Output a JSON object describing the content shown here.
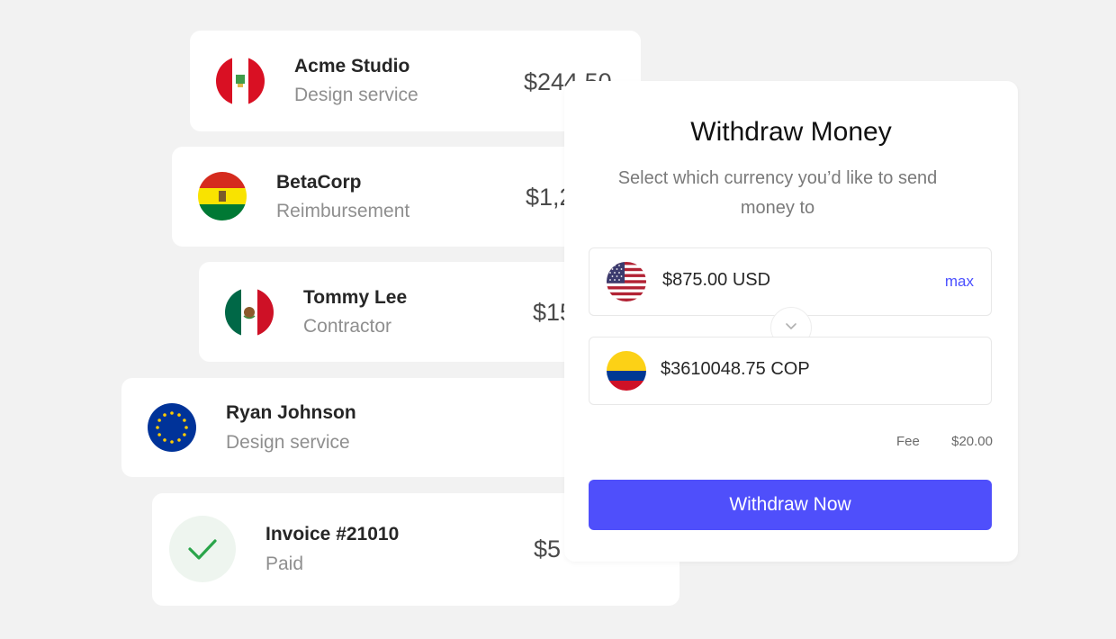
{
  "transactions": [
    {
      "name": "Acme Studio",
      "description": "Design service",
      "amount": "$244.50",
      "flag_icon": "peru-flag-icon"
    },
    {
      "name": "BetaCorp",
      "description": "Reimbursement",
      "amount": "$1,2",
      "flag_icon": "bolivia-flag-icon"
    },
    {
      "name": "Tommy Lee",
      "description": "Contractor",
      "amount": "$15",
      "flag_icon": "mexico-flag-icon"
    },
    {
      "name": "Ryan Johnson",
      "description": "Design service",
      "amount": "",
      "flag_icon": "eu-flag-icon"
    },
    {
      "name": "Invoice #21010",
      "description": "Paid",
      "amount": "$5",
      "icon": "checkmark-icon"
    }
  ],
  "withdraw": {
    "title": "Withdraw Money",
    "subtitle": "Select which currency you’d like to send money to",
    "from": {
      "amount": "$875.00 USD",
      "flag_icon": "usa-flag-icon",
      "max_label": "max"
    },
    "to": {
      "amount": "$3610048.75 COP",
      "flag_icon": "colombia-flag-icon"
    },
    "fee_label": "Fee",
    "fee_value": "$20.00",
    "button_label": "Withdraw Now"
  },
  "colors": {
    "background": "#f2f2f2",
    "accent": "#4f4ffb",
    "success": "#2aa54a",
    "success_bg": "#eef5ef"
  }
}
